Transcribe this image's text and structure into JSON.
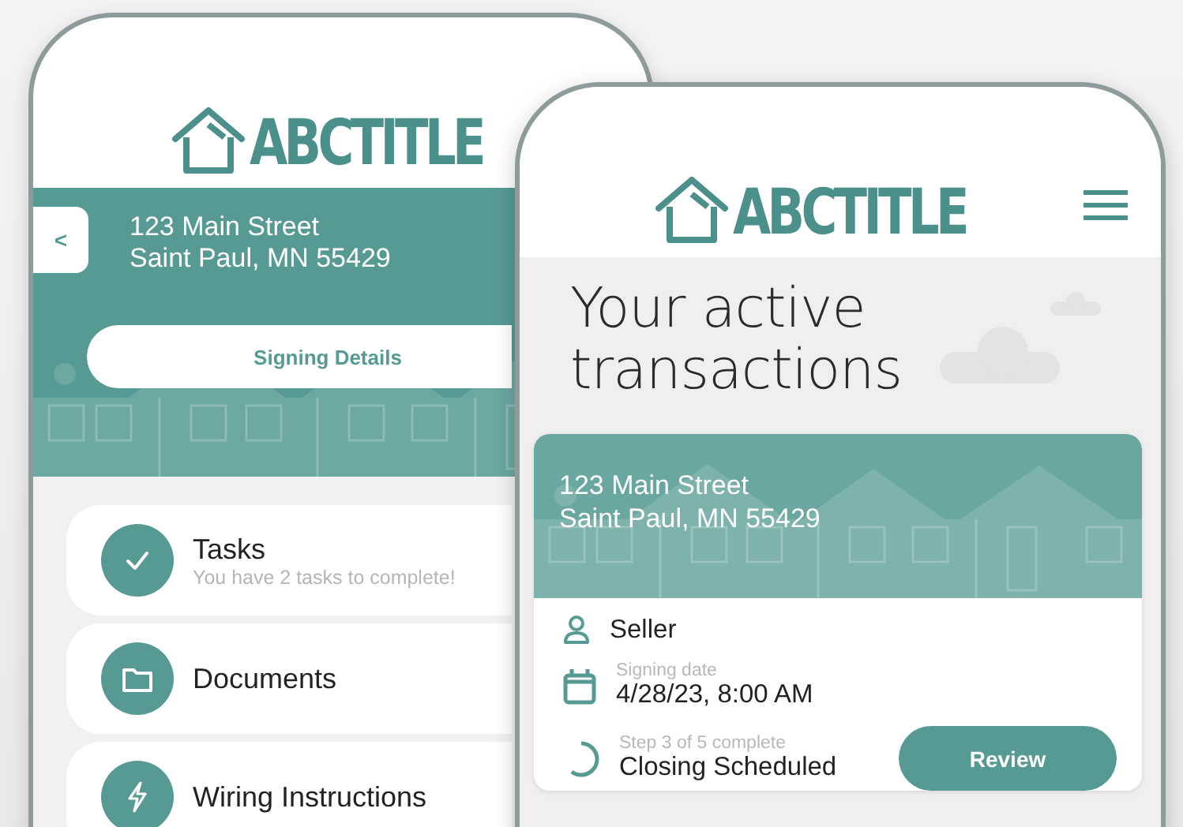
{
  "back_phone": {
    "logo": "ABCTITLE",
    "back_button": "<",
    "address": [
      "123 Main Street",
      "Saint Paul, MN 55429"
    ],
    "signing_details_button": "Signing Details",
    "menu": [
      {
        "kind": "check",
        "title": "Tasks",
        "subtitle": "You have 2 tasks to complete!"
      },
      {
        "kind": "folder",
        "title": "Documents"
      },
      {
        "kind": "bolt",
        "title": "Wiring Instructions"
      }
    ]
  },
  "front_phone": {
    "logo": "ABCTITLE",
    "heading": "Your active transactions",
    "transaction": {
      "address": [
        "123 Main Street",
        "Saint Paul, MN 55429"
      ],
      "role": "Seller",
      "signing_label": "Signing date",
      "signing_date": "4/28/23, 8:00 AM",
      "progress": {
        "label": "Step 3 of 5 complete",
        "status": "Closing Scheduled",
        "level": 0.6
      },
      "review_button": "Review"
    }
  }
}
